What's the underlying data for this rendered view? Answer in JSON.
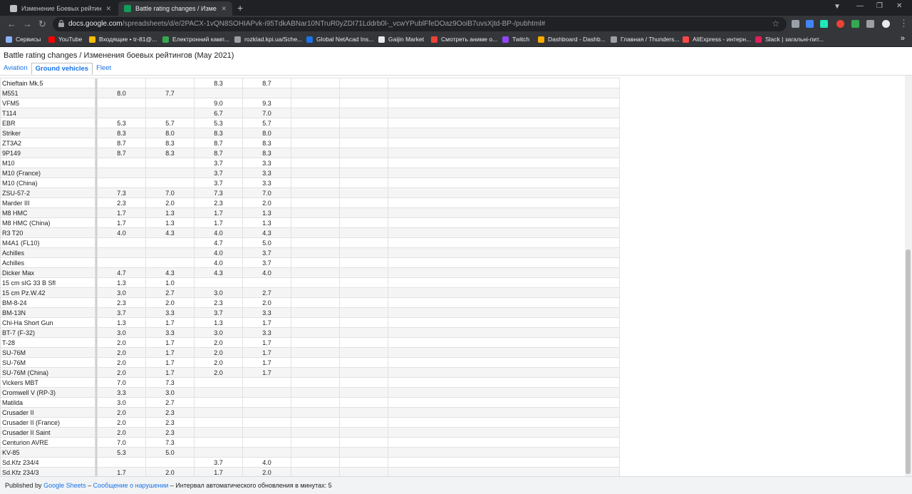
{
  "browser": {
    "tabs": [
      {
        "title": "Изменение Боевых рейтингов",
        "active": false
      },
      {
        "title": "Battle rating changes / Изменен",
        "active": true
      }
    ],
    "url_host": "docs.google.com",
    "url_path": "/spreadsheets/d/e/2PACX-1vQN8SOHIAPvk-i95TdkABNar10NTruR0yZDI71Lddrb0l-_vcwYPublFfeDOaz9OoiB7uvsXjtd-BP-/pubhtml#",
    "bookmarks": [
      {
        "label": "Сервисы",
        "color": "#8ab4f8"
      },
      {
        "label": "YouTube",
        "color": "#ff0000"
      },
      {
        "label": "Входящие • tr-81@...",
        "color": "#fbbc04"
      },
      {
        "label": "Електронний камп...",
        "color": "#34a853"
      },
      {
        "label": "rozklad.kpi.ua/Sche...",
        "color": "#9aa0a6"
      },
      {
        "label": "Global NetAcad Ins...",
        "color": "#1a73e8"
      },
      {
        "label": "Gaijin Market",
        "color": "#e8eaed"
      },
      {
        "label": "Смотреть аниме о...",
        "color": "#ea4335"
      },
      {
        "label": "Twitch",
        "color": "#9146ff"
      },
      {
        "label": "Dashboard - Dashb...",
        "color": "#f9ab00"
      },
      {
        "label": "Главная / Thunders...",
        "color": "#9aa0a6"
      },
      {
        "label": "AliExpress - интерн...",
        "color": "#ff4747"
      },
      {
        "label": "Slack | загальні-пит...",
        "color": "#e01e5a"
      }
    ]
  },
  "doc": {
    "title": "Battle rating changes / Изменения боевых рейтингов (May 2021)",
    "sheet_tabs": [
      {
        "label": "Aviation",
        "active": false
      },
      {
        "label": "Ground vehicles",
        "active": true
      },
      {
        "label": "Fleet",
        "active": false
      }
    ]
  },
  "rows": [
    [
      "Chieftain Mk.5",
      "",
      "",
      "8.3",
      "8.7"
    ],
    [
      "M551",
      "8.0",
      "7.7",
      "",
      ""
    ],
    [
      "VFM5",
      "",
      "",
      "9.0",
      "9.3"
    ],
    [
      "T114",
      "",
      "",
      "6.7",
      "7.0"
    ],
    [
      "EBR",
      "5.3",
      "5.7",
      "5.3",
      "5.7"
    ],
    [
      "Striker",
      "8.3",
      "8.0",
      "8.3",
      "8.0"
    ],
    [
      "ZT3A2",
      "8.7",
      "8.3",
      "8.7",
      "8.3"
    ],
    [
      "9P149",
      "8.7",
      "8.3",
      "8.7",
      "8.3"
    ],
    [
      "M10",
      "",
      "",
      "3.7",
      "3.3"
    ],
    [
      "M10 (France)",
      "",
      "",
      "3.7",
      "3.3"
    ],
    [
      "M10 (China)",
      "",
      "",
      "3.7",
      "3.3"
    ],
    [
      "ZSU-57-2",
      "7.3",
      "7.0",
      "7.3",
      "7.0"
    ],
    [
      "Marder III",
      "2.3",
      "2.0",
      "2.3",
      "2.0"
    ],
    [
      "M8 HMC",
      "1.7",
      "1.3",
      "1.7",
      "1.3"
    ],
    [
      "M8 HMC (China)",
      "1.7",
      "1.3",
      "1.7",
      "1.3"
    ],
    [
      "R3 T20",
      "4.0",
      "4.3",
      "4.0",
      "4.3"
    ],
    [
      "M4A1 (FL10)",
      "",
      "",
      "4.7",
      "5.0"
    ],
    [
      "Achilles",
      "",
      "",
      "4.0",
      "3.7"
    ],
    [
      "Achilles",
      "",
      "",
      "4.0",
      "3.7"
    ],
    [
      "Dicker Max",
      "4.7",
      "4.3",
      "4.3",
      "4.0"
    ],
    [
      "15 cm sIG 33 B Sfl",
      "1.3",
      "1.0",
      "",
      ""
    ],
    [
      "15 cm Pz.W.42",
      "3.0",
      "2.7",
      "3.0",
      "2.7"
    ],
    [
      "BM-8-24",
      "2.3",
      "2.0",
      "2.3",
      "2.0"
    ],
    [
      "BM-13N",
      "3.7",
      "3.3",
      "3.7",
      "3.3"
    ],
    [
      "Chi-Ha Short Gun",
      "1.3",
      "1.7",
      "1.3",
      "1.7"
    ],
    [
      "BT-7 (F-32)",
      "3.0",
      "3.3",
      "3.0",
      "3.3"
    ],
    [
      "T-28",
      "2.0",
      "1.7",
      "2.0",
      "1.7"
    ],
    [
      "SU-76M",
      "2.0",
      "1.7",
      "2.0",
      "1.7"
    ],
    [
      "SU-76M",
      "2.0",
      "1.7",
      "2.0",
      "1.7"
    ],
    [
      "SU-76M (China)",
      "2.0",
      "1.7",
      "2.0",
      "1.7"
    ],
    [
      "Vickers MBT",
      "7.0",
      "7.3",
      "",
      ""
    ],
    [
      "Cromwell V (RP-3)",
      "3.3",
      "3.0",
      "",
      ""
    ],
    [
      "Matilda",
      "3.0",
      "2.7",
      "",
      ""
    ],
    [
      "Crusader II",
      "2.0",
      "2.3",
      "",
      ""
    ],
    [
      "Crusader II (France)",
      "2.0",
      "2.3",
      "",
      ""
    ],
    [
      "Crusader II Saint",
      "2.0",
      "2.3",
      "",
      ""
    ],
    [
      "Centurion AVRE",
      "7.0",
      "7.3",
      "",
      ""
    ],
    [
      "KV-85",
      "5.3",
      "5.0",
      "",
      ""
    ],
    [
      "Sd.Kfz 234/4",
      "",
      "",
      "3.7",
      "4.0"
    ],
    [
      "Sd.Kfz 234/3",
      "1.7",
      "2.0",
      "1.7",
      "2.0"
    ]
  ],
  "footer": {
    "published_by": "Published by",
    "google_sheets": "Google Sheets",
    "dash1": "–",
    "report": "Сообщение о нарушении",
    "dash2": "–",
    "interval": "Интервал автоматического обновления в минутах: 5"
  }
}
